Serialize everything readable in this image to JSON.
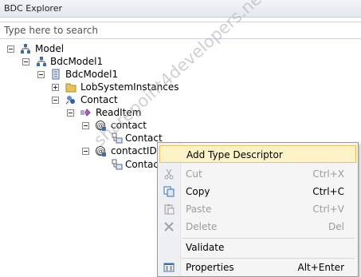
{
  "window": {
    "title": "BDC Explorer"
  },
  "search": {
    "placeholder": "Type here to search"
  },
  "tree": {
    "model": "Model",
    "bdcmodel_outer": "BdcModel1",
    "bdcmodel_inner": "BdcModel1",
    "lobsystem": "LobSystemInstances",
    "contact": "Contact",
    "readitem": "ReadItem",
    "param_contact": "contact",
    "param_contact_child": "Contact",
    "param_contactid": "contactID",
    "param_contactid_child": "Contact"
  },
  "context_menu": {
    "add_type_descriptor": {
      "label": "Add Type Descriptor",
      "shortcut": ""
    },
    "cut": {
      "label": "Cut",
      "shortcut": "Ctrl+X"
    },
    "copy": {
      "label": "Copy",
      "shortcut": "Ctrl+C"
    },
    "paste": {
      "label": "Paste",
      "shortcut": "Ctrl+V"
    },
    "delete": {
      "label": "Delete",
      "shortcut": "Del"
    },
    "validate": {
      "label": "Validate",
      "shortcut": ""
    },
    "properties": {
      "label": "Properties",
      "shortcut": "Alt+Enter"
    }
  },
  "watermark": "sharepoint4developers.net",
  "colors": {
    "highlight": "#fef3c7",
    "highlight_border": "#e5c365",
    "disabled_text": "#9c9c9c"
  }
}
